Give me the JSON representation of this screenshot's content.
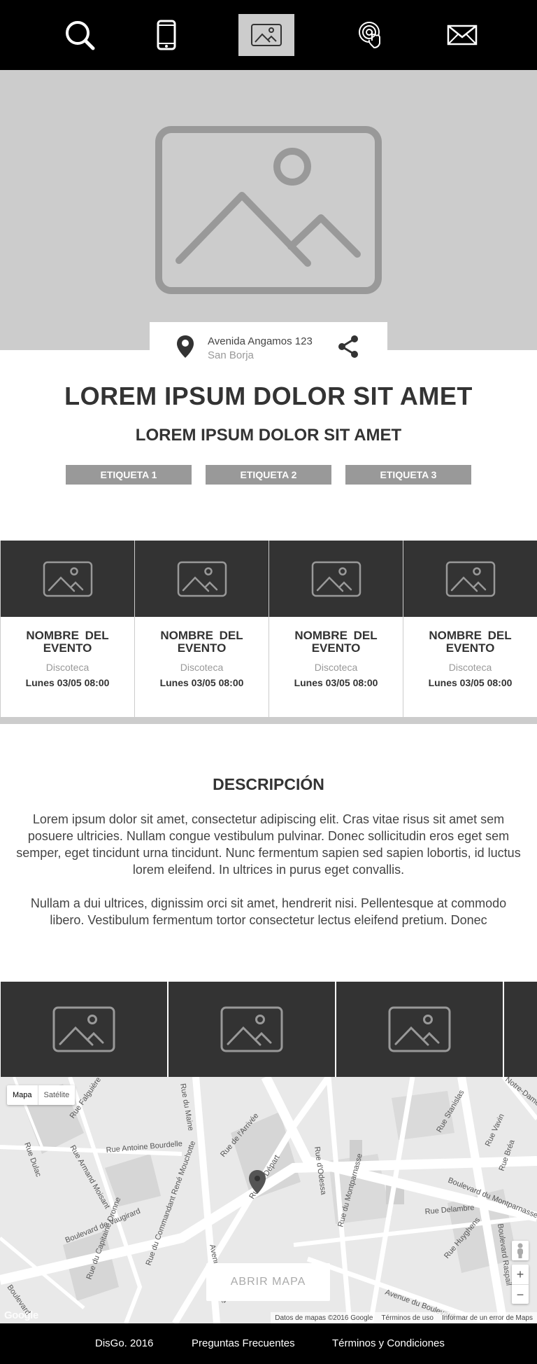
{
  "nav": {
    "items": [
      {
        "icon": "search-icon",
        "active": false
      },
      {
        "icon": "phone-icon",
        "active": false
      },
      {
        "icon": "image-icon",
        "active": true
      },
      {
        "icon": "touch-icon",
        "active": false
      },
      {
        "icon": "mail-icon",
        "active": false
      }
    ],
    "active_bg": "#cccccc"
  },
  "hero": {
    "icon": "image-placeholder-icon",
    "background": "#cccccc"
  },
  "address": {
    "line1": "Avenida Angamos 123",
    "line2": "San Borja",
    "pin_icon": "location-pin-icon",
    "share_icon": "share-icon"
  },
  "event": {
    "title": "LOREM IPSUM DOLOR SIT AMET",
    "subtitle": "LOREM IPSUM DOLOR SIT AMET",
    "tags": [
      "ETIQUETA 1",
      "ETIQUETA 2",
      "ETIQUETA 3"
    ]
  },
  "related_events": [
    {
      "name": "NOMBRE DEL EVENTO",
      "type": "Discoteca",
      "date": "Lunes 03/05 08:00"
    },
    {
      "name": "NOMBRE DEL EVENTO",
      "type": "Discoteca",
      "date": "Lunes 03/05 08:00"
    },
    {
      "name": "NOMBRE DEL EVENTO",
      "type": "Discoteca",
      "date": "Lunes 03/05 08:00"
    },
    {
      "name": "NOMBRE DEL EVENTO",
      "type": "Discoteca",
      "date": "Lunes 03/05 08:00"
    }
  ],
  "description": {
    "title": "DESCRIPCIÓN",
    "paragraph1": "Lorem ipsum dolor sit amet, consectetur adipiscing elit. Cras vitae risus sit amet sem posuere ultricies. Nullam congue vestibulum pulvinar. Donec sollicitudin eros eget sem semper, eget tincidunt urna tincidunt. Nunc fermentum sapien sed sapien lobortis, id luctus lorem eleifend. In ultrices in purus eget convallis.",
    "paragraph2": "Nullam a dui ultrices, dignissim orci sit amet, hendrerit nisi. Pellentesque at commodo libero. Vestibulum fermentum tortor consectetur lectus eleifend pretium. Donec"
  },
  "map": {
    "type_map": "Mapa",
    "type_satellite": "Satélite",
    "open_button": "ABRIR MAPA",
    "zoom_in": "+",
    "zoom_out": "−",
    "attribution": "Datos de mapas ©2016 Google",
    "terms": "Términos de uso",
    "report": "Informar de un error de Maps",
    "google": "Google",
    "streets": [
      "Rue Falguière",
      "Rue Dulac",
      "Rue Antoine Bourdelle",
      "Rue Armand Moisant",
      "Boulevard de Vaugirard",
      "Rue du Maine",
      "Rue de l'Arrivée",
      "Rue du Départ",
      "Rue d'Odessa",
      "Rue du Montparnasse",
      "Rue Stanislas",
      "Rue Vavin",
      "Rue Bréa",
      "Boulevard du Montparnasse",
      "Rue Delambre",
      "Rue Huyghens",
      "Boulevard Raspail",
      "Avenue du Maine",
      "Rue du Commandant René Mouchotte",
      "Avenue du Boulevard",
      "Rue du Capitaine Dronne",
      "Boulevard",
      "Notre-Dame des Champs"
    ]
  },
  "footer": {
    "links": [
      "DisGo. 2016",
      "Preguntas Frecuentes",
      "Términos y Condiciones"
    ]
  }
}
